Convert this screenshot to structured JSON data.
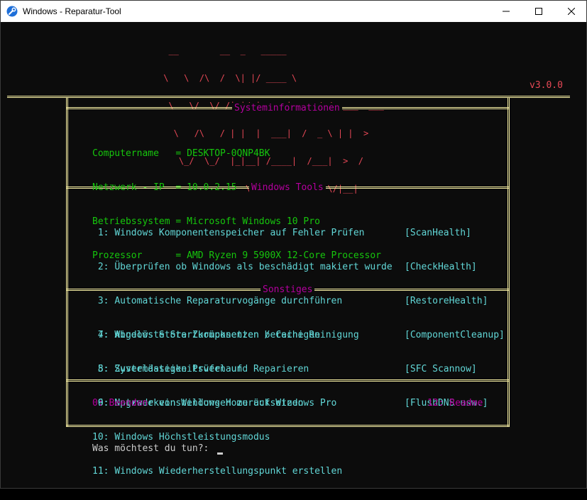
{
  "window": {
    "title": "Windows - Reparatur-Tool",
    "icon": "wrench-icon"
  },
  "banner": {
    "lines": [
      "  __        __  _   _____",
      " \\   \\  /\\  /  \\| |/ ____ \\",
      "  \\   \\/  \\/ /| |/ |     |  ___/ /  ___  ___",
      "   \\   /\\   / | |  |  ___|  /  _ \\ | |  >",
      "    \\_/  \\_/  |_|__| /____|  /___|  >  /",
      "                 \\/       \\/     \\/|__|"
    ],
    "version": "v3.0.0"
  },
  "systeminfo": {
    "title": "Systeminformationen",
    "rows": [
      {
        "label": "Computername   ",
        "value": "DESKTOP-0QNP4BK"
      },
      {
        "label": "Netzwerk - IP  ",
        "value": "10.0.2.15"
      },
      {
        "label": "Betriebssystem ",
        "value": "Microsoft Windows 10 Pro"
      },
      {
        "label": "Prozessor      ",
        "value": "AMD Ryzen 9 5900X 12-Core Processor"
      }
    ]
  },
  "tools": {
    "title": "Windows Tools",
    "items": [
      {
        "num": " 1:",
        "text": "Windows Komponentenspeicher auf Fehler Prüfen",
        "tag": "[ScanHealth]"
      },
      {
        "num": " 2:",
        "text": "Überprüfen ob Windows als beschädigt makiert wurde",
        "tag": "[CheckHealth]"
      },
      {
        "num": " 3:",
        "text": "Automatische Reparaturvogänge durchführen",
        "tag": "[RestoreHealth]"
      },
      {
        "num": " 4:",
        "text": "Abgelöste Startkomponenten bereinigen",
        "tag": "[ComponentCleanup]"
      },
      {
        "num": " 5:",
        "text": "Systemdateien Prüfen und Reparieren",
        "tag": "[SFC Scannow]"
      },
      {
        "num": " 6:",
        "text": "Netzwerkeinstellungen zurücksetzen",
        "tag": "[FlushDNS usw.]"
      }
    ]
  },
  "other": {
    "title": "Sonstiges",
    "items": [
      {
        "num": " 7:",
        "text": "Windows Store Zurücksetzen / Cache Reinigung"
      },
      {
        "num": " 8:",
        "text": "Zuverlässigkeitsverlauf"
      },
      {
        "num": " 9:",
        "text": "Upgrade von Windows Home auf Windows Pro"
      },
      {
        "num": "10:",
        "text": "Windows Höchstleistungsmodus"
      },
      {
        "num": "11:",
        "text": "Windows Wiederherstellungspunkt erstellen"
      }
    ]
  },
  "footer": {
    "exit": "0: Beenden",
    "readme": "12: Readme"
  },
  "prompt": {
    "text": "Was möchtest du tun?: "
  }
}
